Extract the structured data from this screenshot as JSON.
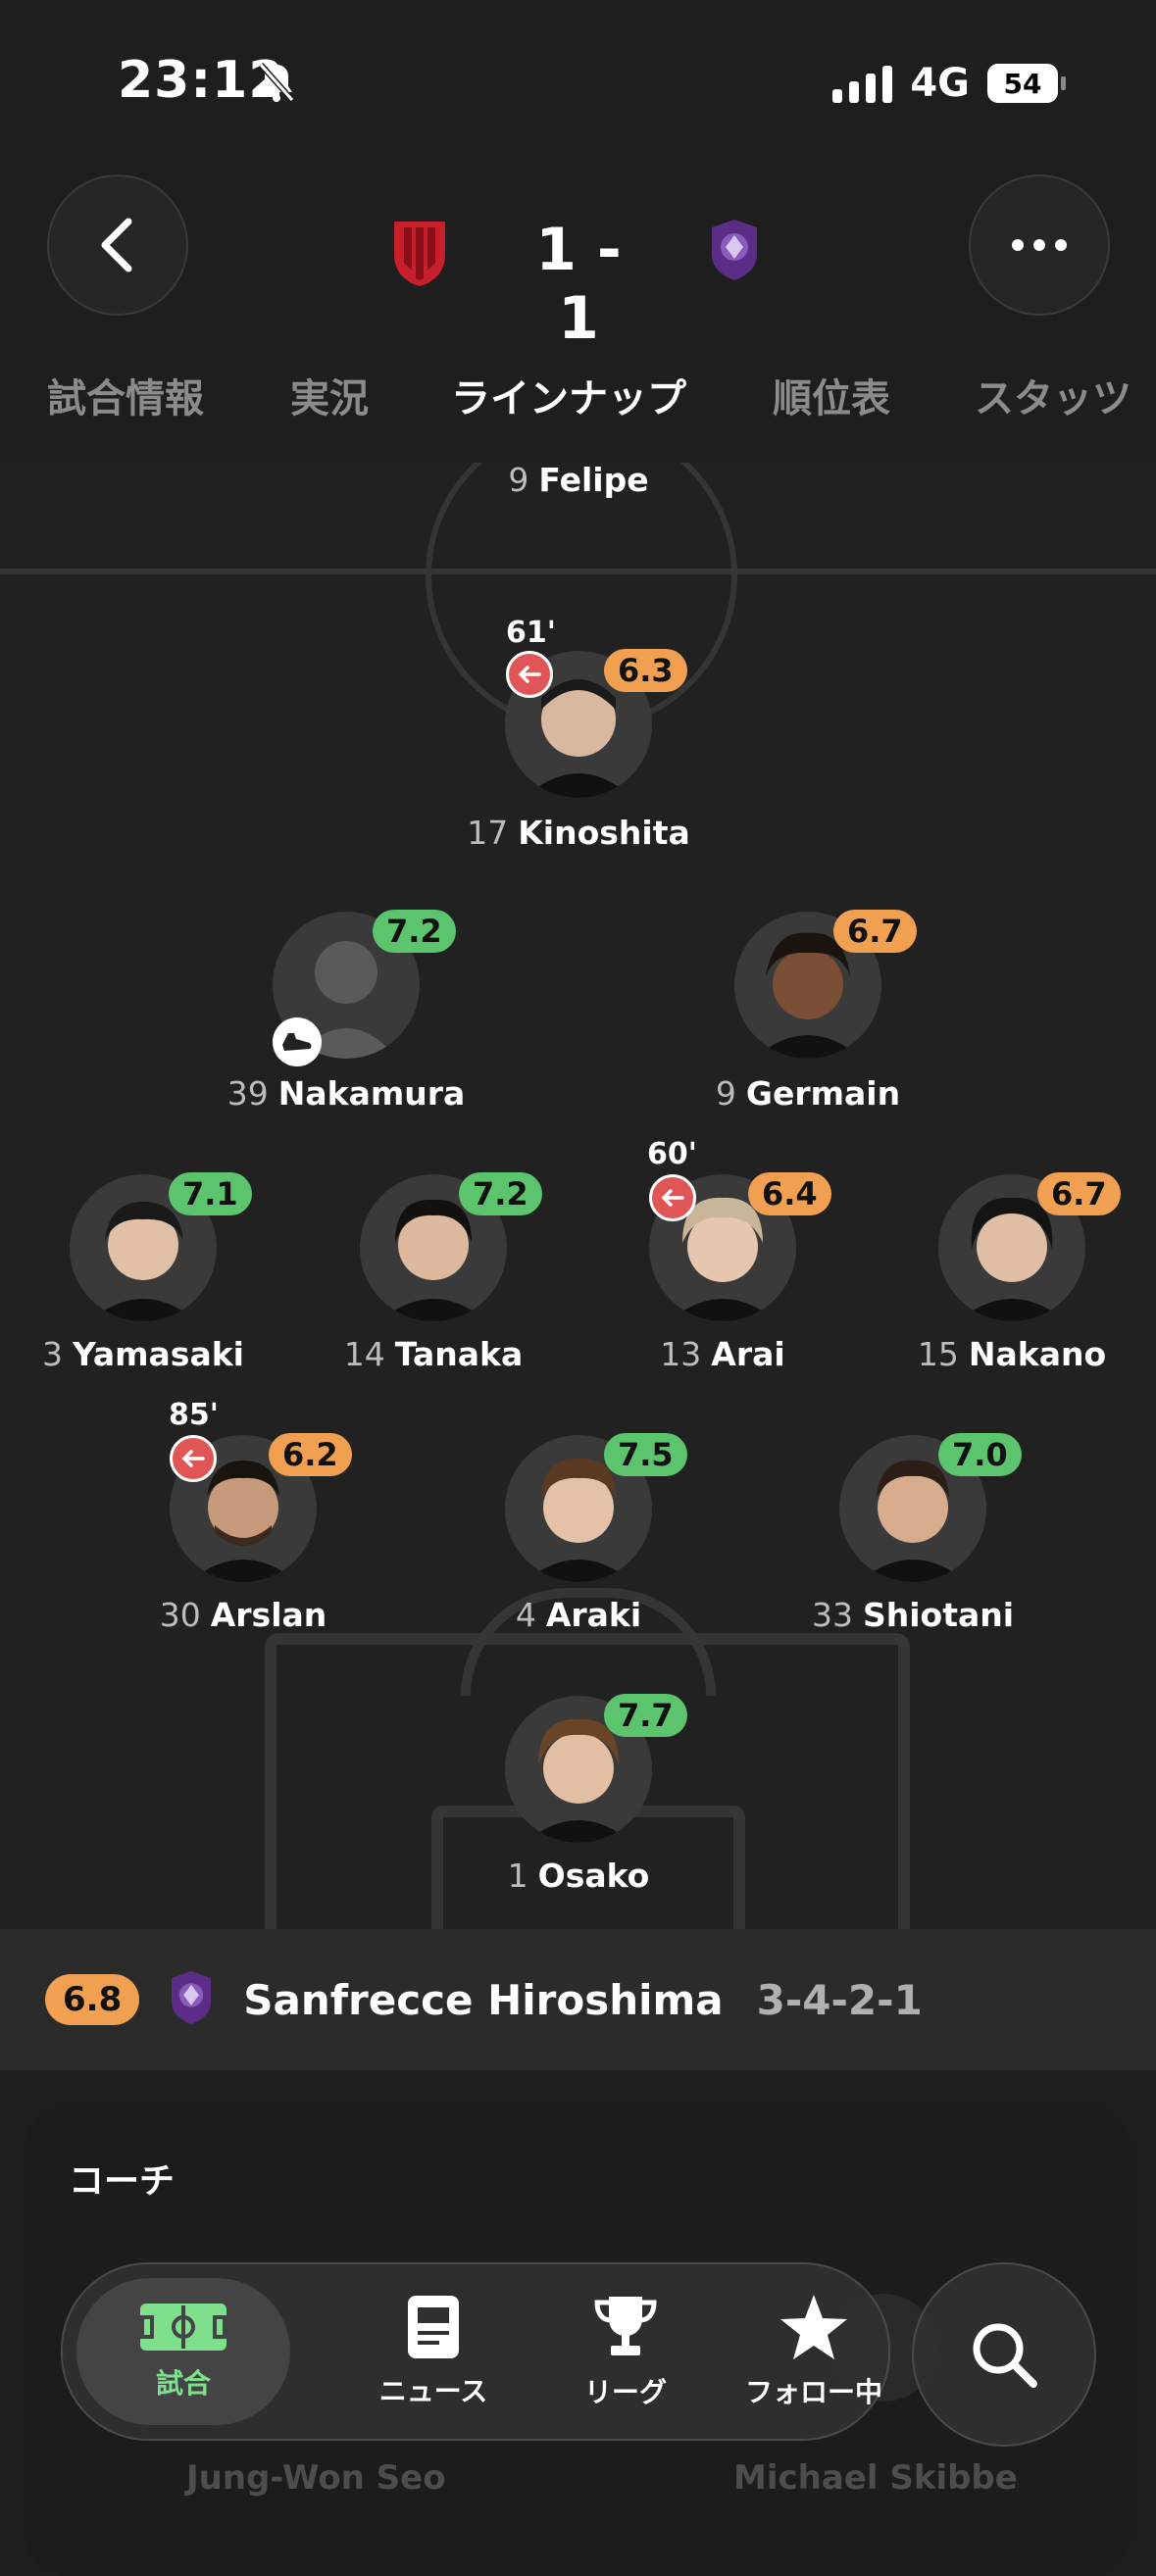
{
  "status_bar": {
    "time": "23:12",
    "network": "4G",
    "battery": "54"
  },
  "header": {
    "score": "1 - 1",
    "home_crest_icon": "red-shield-crest-icon",
    "away_crest_icon": "purple-sanfrecce-crest-icon"
  },
  "tabs": [
    "試合情報",
    "実況",
    "ラインナップ",
    "順位表",
    "スタッツ"
  ],
  "active_tab": "ラインナップ",
  "players": [
    {
      "number": "9",
      "name": "Felipe",
      "rating": "",
      "rating_color": "",
      "sub": ""
    },
    {
      "number": "17",
      "name": "Kinoshita",
      "rating": "6.3",
      "rating_color": "orange",
      "sub": "61'"
    },
    {
      "number": "39",
      "name": "Nakamura",
      "rating": "7.2",
      "rating_color": "green",
      "sub": ""
    },
    {
      "number": "9",
      "name": "Germain",
      "rating": "6.7",
      "rating_color": "orange",
      "sub": ""
    },
    {
      "number": "3",
      "name": "Yamasaki",
      "rating": "7.1",
      "rating_color": "green",
      "sub": ""
    },
    {
      "number": "14",
      "name": "Tanaka",
      "rating": "7.2",
      "rating_color": "green",
      "sub": ""
    },
    {
      "number": "13",
      "name": "Arai",
      "rating": "6.4",
      "rating_color": "orange",
      "sub": "60'"
    },
    {
      "number": "15",
      "name": "Nakano",
      "rating": "6.7",
      "rating_color": "orange",
      "sub": ""
    },
    {
      "number": "30",
      "name": "Arslan",
      "rating": "6.2",
      "rating_color": "orange",
      "sub": "85'"
    },
    {
      "number": "4",
      "name": "Araki",
      "rating": "7.5",
      "rating_color": "green",
      "sub": ""
    },
    {
      "number": "33",
      "name": "Shiotani",
      "rating": "7.0",
      "rating_color": "green",
      "sub": ""
    },
    {
      "number": "1",
      "name": "Osako",
      "rating": "7.7",
      "rating_color": "green",
      "sub": ""
    }
  ],
  "team": {
    "rating": "6.8",
    "name": "Sanfrecce Hiroshima",
    "formation": "3-4-2-1"
  },
  "coach": {
    "title": "コーチ",
    "names": [
      "Jung-Won Seo",
      "Michael Skibbe"
    ]
  },
  "tabbar": {
    "items": [
      {
        "label": "試合",
        "icon": "pitch-icon"
      },
      {
        "label": "ニュース",
        "icon": "news-icon"
      },
      {
        "label": "リーグ",
        "icon": "trophy-icon"
      },
      {
        "label": "フォロー中",
        "icon": "star-icon"
      }
    ],
    "search_icon": "search-icon"
  },
  "colors": {
    "rating_green": "#5bc46d",
    "rating_orange": "#f0a050",
    "sub_out": "#e05555",
    "active_tab": "#7ee08c"
  }
}
